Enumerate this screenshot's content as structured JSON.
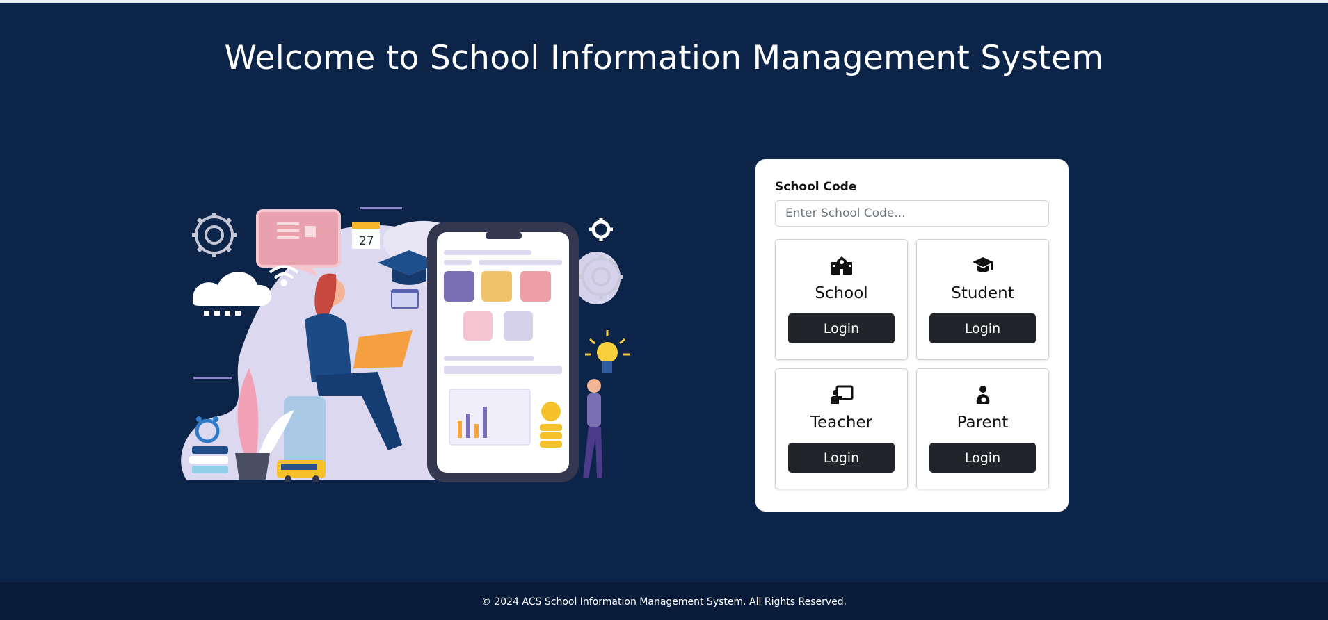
{
  "header": {
    "title": "Welcome to School Information Management System"
  },
  "illustration": {
    "calendar_day": "27"
  },
  "login_form": {
    "school_code_label": "School Code",
    "school_code_placeholder": "Enter School Code...",
    "school_code_value": "",
    "roles": [
      {
        "name": "School",
        "icon": "school-building-icon",
        "button_label": "Login"
      },
      {
        "name": "Student",
        "icon": "graduation-cap-icon",
        "button_label": "Login"
      },
      {
        "name": "Teacher",
        "icon": "teacher-board-icon",
        "button_label": "Login"
      },
      {
        "name": "Parent",
        "icon": "parent-child-icon",
        "button_label": "Login"
      }
    ]
  },
  "footer": {
    "text": "© 2024 ACS School Information Management System. All Rights Reserved."
  },
  "colors": {
    "background": "#0b2447",
    "footer_background": "#081c3a",
    "card_background": "#ffffff",
    "button_background": "#212529"
  }
}
